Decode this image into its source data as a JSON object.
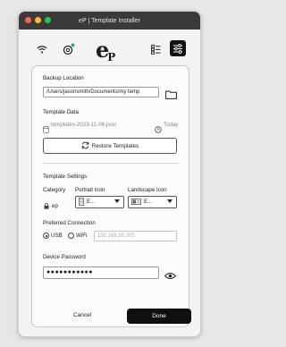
{
  "window": {
    "title": "eP | Template Installer"
  },
  "toolbar": {
    "logo_main": "e",
    "logo_sub": "P"
  },
  "backup": {
    "label": "Backup Location",
    "path": "/Users/jasonsmith/Documents/my temp"
  },
  "template_data": {
    "label": "Template Data",
    "file": "templates-2023-11-06.json",
    "date": "Today"
  },
  "restore": {
    "label": "Restore Templates"
  },
  "settings": {
    "label": "Template Settings",
    "category_label": "Category",
    "category_value": "ep",
    "portrait_label": "Portrait Icon",
    "portrait_value": "E...",
    "landscape_label": "Landscape Icon",
    "landscape_value": "E..."
  },
  "connection": {
    "label": "Preferred Connection",
    "usb_label": "USB",
    "wifi_label": "WiFi",
    "ip_placeholder": "192.168.50.205",
    "selected": "USB"
  },
  "password": {
    "label": "Device Password",
    "masked": "●●●●●●●●●●●"
  },
  "actions": {
    "cancel": "Cancel",
    "done": "Done"
  }
}
